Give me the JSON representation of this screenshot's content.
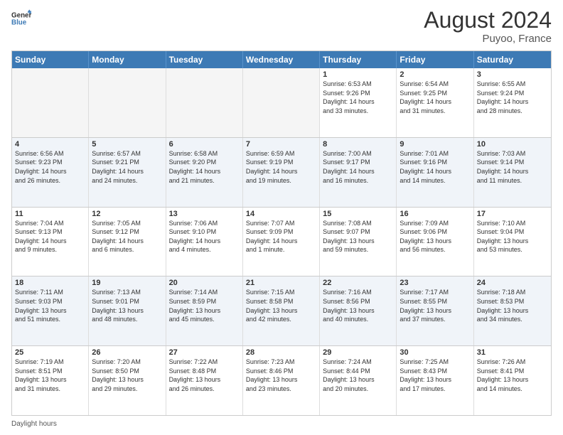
{
  "logo": {
    "line1": "General",
    "line2": "Blue"
  },
  "title": "August 2024",
  "location": "Puyoo, France",
  "header_days": [
    "Sunday",
    "Monday",
    "Tuesday",
    "Wednesday",
    "Thursday",
    "Friday",
    "Saturday"
  ],
  "weeks": [
    [
      {
        "day": "",
        "info": ""
      },
      {
        "day": "",
        "info": ""
      },
      {
        "day": "",
        "info": ""
      },
      {
        "day": "",
        "info": ""
      },
      {
        "day": "1",
        "info": "Sunrise: 6:53 AM\nSunset: 9:26 PM\nDaylight: 14 hours\nand 33 minutes."
      },
      {
        "day": "2",
        "info": "Sunrise: 6:54 AM\nSunset: 9:25 PM\nDaylight: 14 hours\nand 31 minutes."
      },
      {
        "day": "3",
        "info": "Sunrise: 6:55 AM\nSunset: 9:24 PM\nDaylight: 14 hours\nand 28 minutes."
      }
    ],
    [
      {
        "day": "4",
        "info": "Sunrise: 6:56 AM\nSunset: 9:23 PM\nDaylight: 14 hours\nand 26 minutes."
      },
      {
        "day": "5",
        "info": "Sunrise: 6:57 AM\nSunset: 9:21 PM\nDaylight: 14 hours\nand 24 minutes."
      },
      {
        "day": "6",
        "info": "Sunrise: 6:58 AM\nSunset: 9:20 PM\nDaylight: 14 hours\nand 21 minutes."
      },
      {
        "day": "7",
        "info": "Sunrise: 6:59 AM\nSunset: 9:19 PM\nDaylight: 14 hours\nand 19 minutes."
      },
      {
        "day": "8",
        "info": "Sunrise: 7:00 AM\nSunset: 9:17 PM\nDaylight: 14 hours\nand 16 minutes."
      },
      {
        "day": "9",
        "info": "Sunrise: 7:01 AM\nSunset: 9:16 PM\nDaylight: 14 hours\nand 14 minutes."
      },
      {
        "day": "10",
        "info": "Sunrise: 7:03 AM\nSunset: 9:14 PM\nDaylight: 14 hours\nand 11 minutes."
      }
    ],
    [
      {
        "day": "11",
        "info": "Sunrise: 7:04 AM\nSunset: 9:13 PM\nDaylight: 14 hours\nand 9 minutes."
      },
      {
        "day": "12",
        "info": "Sunrise: 7:05 AM\nSunset: 9:12 PM\nDaylight: 14 hours\nand 6 minutes."
      },
      {
        "day": "13",
        "info": "Sunrise: 7:06 AM\nSunset: 9:10 PM\nDaylight: 14 hours\nand 4 minutes."
      },
      {
        "day": "14",
        "info": "Sunrise: 7:07 AM\nSunset: 9:09 PM\nDaylight: 14 hours\nand 1 minute."
      },
      {
        "day": "15",
        "info": "Sunrise: 7:08 AM\nSunset: 9:07 PM\nDaylight: 13 hours\nand 59 minutes."
      },
      {
        "day": "16",
        "info": "Sunrise: 7:09 AM\nSunset: 9:06 PM\nDaylight: 13 hours\nand 56 minutes."
      },
      {
        "day": "17",
        "info": "Sunrise: 7:10 AM\nSunset: 9:04 PM\nDaylight: 13 hours\nand 53 minutes."
      }
    ],
    [
      {
        "day": "18",
        "info": "Sunrise: 7:11 AM\nSunset: 9:03 PM\nDaylight: 13 hours\nand 51 minutes."
      },
      {
        "day": "19",
        "info": "Sunrise: 7:13 AM\nSunset: 9:01 PM\nDaylight: 13 hours\nand 48 minutes."
      },
      {
        "day": "20",
        "info": "Sunrise: 7:14 AM\nSunset: 8:59 PM\nDaylight: 13 hours\nand 45 minutes."
      },
      {
        "day": "21",
        "info": "Sunrise: 7:15 AM\nSunset: 8:58 PM\nDaylight: 13 hours\nand 42 minutes."
      },
      {
        "day": "22",
        "info": "Sunrise: 7:16 AM\nSunset: 8:56 PM\nDaylight: 13 hours\nand 40 minutes."
      },
      {
        "day": "23",
        "info": "Sunrise: 7:17 AM\nSunset: 8:55 PM\nDaylight: 13 hours\nand 37 minutes."
      },
      {
        "day": "24",
        "info": "Sunrise: 7:18 AM\nSunset: 8:53 PM\nDaylight: 13 hours\nand 34 minutes."
      }
    ],
    [
      {
        "day": "25",
        "info": "Sunrise: 7:19 AM\nSunset: 8:51 PM\nDaylight: 13 hours\nand 31 minutes."
      },
      {
        "day": "26",
        "info": "Sunrise: 7:20 AM\nSunset: 8:50 PM\nDaylight: 13 hours\nand 29 minutes."
      },
      {
        "day": "27",
        "info": "Sunrise: 7:22 AM\nSunset: 8:48 PM\nDaylight: 13 hours\nand 26 minutes."
      },
      {
        "day": "28",
        "info": "Sunrise: 7:23 AM\nSunset: 8:46 PM\nDaylight: 13 hours\nand 23 minutes."
      },
      {
        "day": "29",
        "info": "Sunrise: 7:24 AM\nSunset: 8:44 PM\nDaylight: 13 hours\nand 20 minutes."
      },
      {
        "day": "30",
        "info": "Sunrise: 7:25 AM\nSunset: 8:43 PM\nDaylight: 13 hours\nand 17 minutes."
      },
      {
        "day": "31",
        "info": "Sunrise: 7:26 AM\nSunset: 8:41 PM\nDaylight: 13 hours\nand 14 minutes."
      }
    ]
  ],
  "footer": {
    "daylight_label": "Daylight hours"
  },
  "colors": {
    "header_bg": "#3d7ab5",
    "alt_row_bg": "#f0f4f9",
    "empty_bg": "#f5f5f5"
  }
}
